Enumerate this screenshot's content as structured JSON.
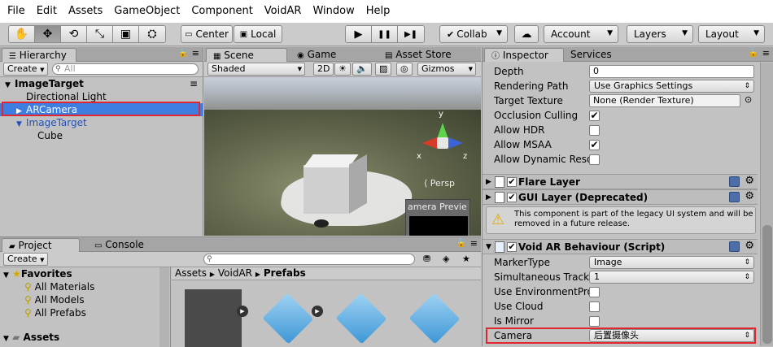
{
  "menu": [
    "File",
    "Edit",
    "Assets",
    "GameObject",
    "Component",
    "VoidAR",
    "Window",
    "Help"
  ],
  "toolbar": {
    "tools": [
      "✋",
      "✥",
      "⟲",
      "⤡",
      "▣",
      "⛭"
    ],
    "pivot": "Center",
    "space": "Local",
    "play": "▶",
    "pause": "❚❚",
    "step": "▶❚",
    "collab": "Collab",
    "account": "Account",
    "layers": "Layers",
    "layout": "Layout"
  },
  "hierarchy": {
    "tab": "Hierarchy",
    "create": "Create",
    "search_placeholder": "All",
    "items": [
      {
        "label": "ImageTarget",
        "indent": 0,
        "bold": true,
        "arrow": "▼"
      },
      {
        "label": "Directional Light",
        "indent": 1,
        "bold": false,
        "arrow": ""
      },
      {
        "label": "ARCamera",
        "indent": 1,
        "bold": false,
        "arrow": "▶",
        "selected": true
      },
      {
        "label": "ImageTarget",
        "indent": 1,
        "bold": false,
        "arrow": "▼",
        "blue": true
      },
      {
        "label": "Cube",
        "indent": 2,
        "bold": false,
        "arrow": ""
      }
    ]
  },
  "scene": {
    "tab_scene": "Scene",
    "tab_game": "Game",
    "tab_asset_store": "Asset Store",
    "shading": "Shaded",
    "mode2d": "2D",
    "gizmos": "Gizmos",
    "persp": "Persp",
    "preview_label": "amera Previe",
    "axis_y": "y",
    "axis_x": "x",
    "axis_z": "z"
  },
  "project": {
    "tab_project": "Project",
    "tab_console": "Console",
    "create": "Create",
    "favorites": "Favorites",
    "fav_items": [
      "All Materials",
      "All Models",
      "All Prefabs"
    ],
    "assets": "Assets",
    "breadcrumb": [
      "Assets",
      "VoidAR",
      "Prefabs"
    ]
  },
  "inspector": {
    "tab_inspector": "Inspector",
    "tab_services": "Services",
    "camera_rows": [
      {
        "label": "Depth",
        "kind": "field",
        "value": "0"
      },
      {
        "label": "Rendering Path",
        "kind": "select",
        "value": "Use Graphics Settings"
      },
      {
        "label": "Target Texture",
        "kind": "object",
        "value": "None (Render Texture)"
      },
      {
        "label": "Occlusion Culling",
        "kind": "check",
        "checked": true
      },
      {
        "label": "Allow HDR",
        "kind": "check",
        "checked": false
      },
      {
        "label": "Allow MSAA",
        "kind": "check",
        "checked": true
      },
      {
        "label": "Allow Dynamic Reso",
        "kind": "check",
        "checked": false
      }
    ],
    "flare_layer": "Flare Layer",
    "gui_layer": "GUI Layer (Deprecated)",
    "warning": "This component is part of the legacy UI system and will be removed in a future release.",
    "voidar_title": "Void AR Behaviour (Script)",
    "voidar_rows": [
      {
        "label": "MarkerType",
        "kind": "select",
        "value": "Image"
      },
      {
        "label": "Simultaneous Tracki",
        "kind": "select",
        "value": "1"
      },
      {
        "label": "Use EnvironmentPro",
        "kind": "check",
        "checked": false
      },
      {
        "label": "Use Cloud",
        "kind": "check",
        "checked": false
      },
      {
        "label": "Is Mirror",
        "kind": "check",
        "checked": false
      },
      {
        "label": "Camera",
        "kind": "select",
        "value": "后置摄像头"
      }
    ]
  },
  "colors": {
    "selection": "#3e7ee0",
    "highlight": "#e0262e",
    "link_blue": "#2450b8"
  }
}
